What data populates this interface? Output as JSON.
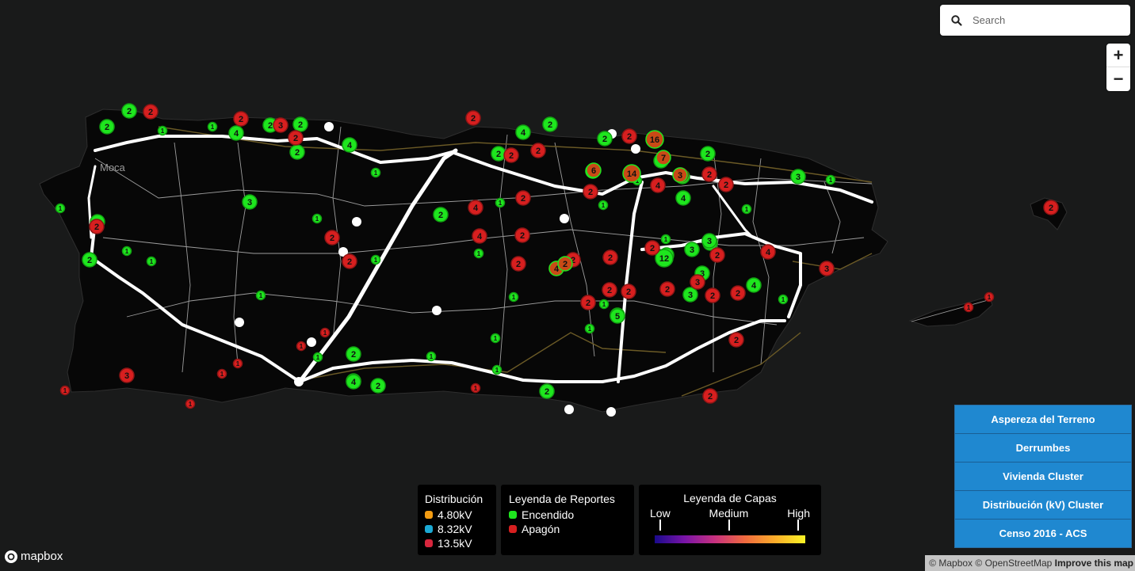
{
  "search": {
    "placeholder": "Search"
  },
  "zoom": {
    "in_label": "+",
    "out_label": "−"
  },
  "map": {
    "place_label": "Moca",
    "colors": {
      "background": "#191a1a",
      "land": "#070707",
      "roads_major": "#ffffff",
      "roads_minor": "#c9c9c9",
      "lines": "#6b5a26",
      "encendido": "#1ee61e",
      "apagon": "#d71f1f"
    }
  },
  "layers_menu": [
    {
      "label": "Aspereza del Terreno"
    },
    {
      "label": "Derrumbes"
    },
    {
      "label": "Vivienda Cluster"
    },
    {
      "label": "Distribución (kV) Cluster"
    },
    {
      "label": "Censo 2016 - ACS"
    }
  ],
  "legend_distribucion": {
    "title": "Distribución",
    "items": [
      {
        "label": "4.80kV",
        "color": "#f39c12"
      },
      {
        "label": "8.32kV",
        "color": "#1ba9d4"
      },
      {
        "label": "13.5kV",
        "color": "#d7263d"
      }
    ]
  },
  "legend_reportes": {
    "title": "Leyenda de Reportes",
    "items": [
      {
        "label": "Encendido",
        "color": "#1ee61e"
      },
      {
        "label": "Apagón",
        "color": "#d71f1f"
      }
    ]
  },
  "legend_capas": {
    "title": "Leyenda de Capas",
    "low": "Low",
    "medium": "Medium",
    "high": "High"
  },
  "branding": {
    "logo_text": "mapbox"
  },
  "attribution": {
    "mapbox": "© Mapbox",
    "osm": "© OpenStreetMap",
    "improve": "Improve this map"
  },
  "markers": {
    "encendido": [
      "2",
      "2",
      "4",
      "2",
      "2",
      "1",
      "1",
      "4",
      "1",
      "2",
      "4",
      "2",
      "2",
      "1",
      "2",
      "1",
      "1",
      "1",
      "2",
      "2",
      "1",
      "1",
      "3",
      "1",
      "1",
      "1",
      "1",
      "2",
      "1",
      "3",
      "2",
      "2",
      "2",
      "1",
      "1",
      "2",
      "2",
      "2",
      "4",
      "1",
      "1",
      "2",
      "1",
      "5",
      "1",
      "2",
      "3",
      "3",
      "3",
      "1",
      "12",
      "5",
      "4",
      "3",
      "1",
      "1",
      "4",
      "3",
      "1",
      "1"
    ],
    "apagon": [
      "2",
      "2",
      "3",
      "2",
      "2",
      "2",
      "2",
      "2",
      "4",
      "2",
      "2",
      "4",
      "2",
      "2",
      "2",
      "2",
      "2",
      "2",
      "4",
      "2",
      "4",
      "2",
      "2",
      "2",
      "2",
      "2",
      "3",
      "2",
      "4",
      "2",
      "2",
      "2",
      "2",
      "3",
      "2",
      "2",
      "3",
      "2",
      "2",
      "1",
      "1",
      "1",
      "1",
      "1",
      "1",
      "1",
      "1",
      "1"
    ],
    "cluster": [
      "16",
      "14",
      "6",
      "7",
      "4",
      "2",
      "6",
      "3"
    ]
  }
}
